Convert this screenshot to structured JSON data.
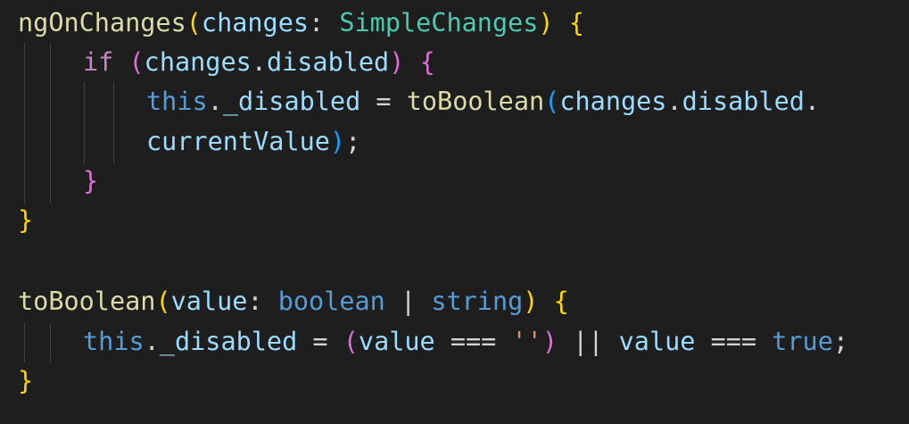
{
  "code": {
    "line1": {
      "fn": "ngOnChanges",
      "open_paren": "(",
      "param": "changes",
      "colon": ": ",
      "type": "SimpleChanges",
      "close_paren": ")",
      "space": " ",
      "open_brace": "{"
    },
    "line2": {
      "kw": "if",
      "space": " ",
      "open_paren": "(",
      "obj": "changes",
      "dot": ".",
      "prop": "disabled",
      "close_paren": ")",
      "space2": " ",
      "open_brace": "{"
    },
    "line3": {
      "this": "this",
      "dot": ".",
      "prop": "_disabled",
      "assign": " = ",
      "fn": "toBoolean",
      "open_paren": "(",
      "obj": "changes",
      "dot2": ".",
      "prop2": "disabled",
      "dot3": "."
    },
    "line4": {
      "prop": "currentValue",
      "close_paren": ")",
      "semi": ";"
    },
    "line5": {
      "close_brace": "}"
    },
    "line6": {
      "close_brace": "}"
    },
    "line8": {
      "fn": "toBoolean",
      "open_paren": "(",
      "param": "value",
      "colon": ": ",
      "type1": "boolean",
      "pipe": " | ",
      "type2": "string",
      "close_paren": ")",
      "space": " ",
      "open_brace": "{"
    },
    "line9": {
      "this": "this",
      "dot": ".",
      "prop": "_disabled",
      "assign": " = ",
      "open_paren": "(",
      "var": "value",
      "eq": " === ",
      "str": "''",
      "close_paren": ")",
      "or": " || ",
      "var2": "value",
      "eq2": " === ",
      "bool": "true",
      "semi": ";"
    },
    "line10": {
      "close_brace": "}"
    }
  },
  "colors": {
    "background": "#1e1e1e",
    "function": "#dcdcaa",
    "variable": "#9cdcfe",
    "type": "#4ec9b0",
    "keyword_control": "#c586c0",
    "keyword": "#569cd6",
    "string": "#ce9178",
    "bracket_level1": "#ffd700",
    "bracket_level2": "#da70d6",
    "bracket_level3": "#179fff"
  }
}
